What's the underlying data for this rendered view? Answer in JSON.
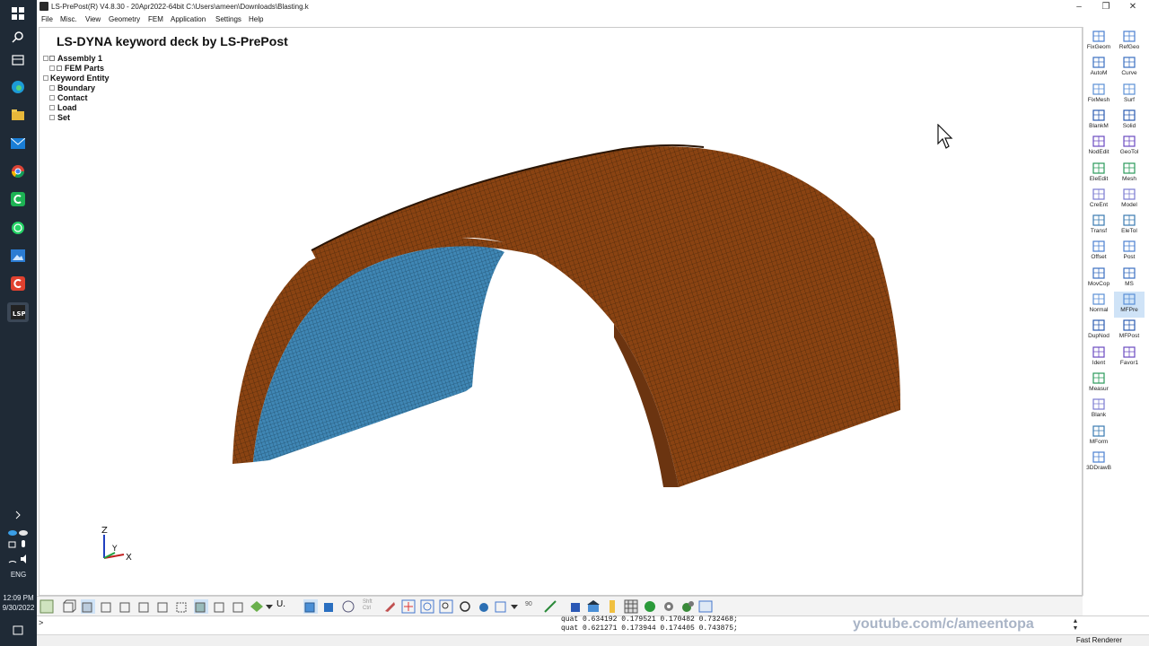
{
  "window": {
    "title": "LS-PrePost(R) V4.8.30 - 20Apr2022-64bit C:\\Users\\ameen\\Downloads\\Blasting.k",
    "minimize": "–",
    "maximize": "❐",
    "close": "✕"
  },
  "menu": [
    "File",
    "Misc.",
    "View",
    "Geometry",
    "FEM",
    "Application",
    "Settings",
    "Help"
  ],
  "viewport": {
    "deck_title": "LS-DYNA keyword deck by LS-PrePost",
    "tree": [
      {
        "label": "Assembly 1",
        "level": 0,
        "expand": true,
        "check": true
      },
      {
        "label": "FEM Parts",
        "level": 1,
        "expand": true,
        "check": true
      },
      {
        "label": "Keyword Entity",
        "level": 0,
        "expand": true,
        "check": false
      },
      {
        "label": "Boundary",
        "level": 1,
        "expand": true,
        "check": false
      },
      {
        "label": "Contact",
        "level": 1,
        "expand": true,
        "check": false
      },
      {
        "label": "Load",
        "level": 1,
        "expand": true,
        "check": false
      },
      {
        "label": "Set",
        "level": 1,
        "expand": true,
        "check": false
      }
    ],
    "axis": {
      "z": "Z",
      "y": "Y",
      "x": "X"
    },
    "colors": {
      "shell": "#8a4312",
      "liner": "#3f86b4",
      "mesh": "#3a2109"
    }
  },
  "tools": {
    "left": [
      "FixGeom",
      "AutoM",
      "FixMesh",
      "BlankM",
      "NodEdit",
      "EleEdit",
      "CreEnt",
      "Transf",
      "Offset",
      "MovCop",
      "Normal",
      "DupNod",
      "Ident",
      "Measur",
      "Blank",
      "MForm",
      "3DDrawB"
    ],
    "right": [
      "RefGeo",
      "Curve",
      "Surf",
      "Solid",
      "GeoTol",
      "Mesh",
      "Model",
      "EleTol",
      "Post",
      "MS",
      "MFPre",
      "MFPost",
      "Favor1"
    ],
    "active": "MFPre"
  },
  "bottom_toolbar": {
    "u_label": "U.",
    "angle": "90",
    "shift": "Shft",
    "ctrl": "Ctrl"
  },
  "command": {
    "prompt": ">",
    "quat_lines": [
      "quat 0.634192 0.179521 0.170482 0.732468;",
      "quat 0.621271 0.173944 0.174405 0.743875;"
    ],
    "watermark": "youtube.com/c/ameentopa"
  },
  "status": {
    "renderer": "Fast Renderer"
  },
  "taskbar": {
    "lang": "ENG",
    "time": "12:09 PM",
    "date": "9/30/2022"
  }
}
